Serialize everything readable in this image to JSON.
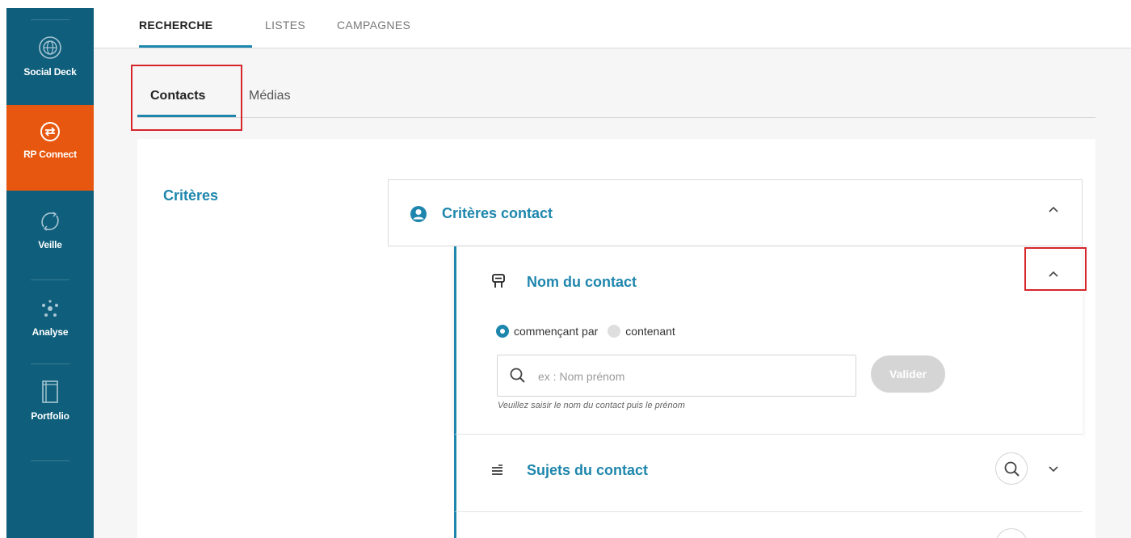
{
  "sidebar": {
    "items": [
      {
        "label": "Social Deck",
        "icon": "globe-icon"
      },
      {
        "label": "RP Connect",
        "icon": "exchange-icon",
        "active": true
      },
      {
        "label": "Veille",
        "icon": "refresh-icon"
      },
      {
        "label": "Analyse",
        "icon": "network-icon"
      },
      {
        "label": "Portfolio",
        "icon": "book-icon"
      }
    ],
    "colors": {
      "background": "#0f5f7c",
      "active": "#e8570f"
    }
  },
  "topnav": {
    "tabs": [
      {
        "label": "RECHERCHE",
        "active": true
      },
      {
        "label": "LISTES"
      },
      {
        "label": "CAMPAGNES"
      }
    ]
  },
  "subtabs": {
    "tabs": [
      {
        "label": "Contacts",
        "active": true
      },
      {
        "label": "Médias"
      }
    ]
  },
  "main": {
    "criteres_title": "Critères",
    "section": {
      "title": "Critères contact",
      "icon": "user-circle-icon"
    },
    "name_card": {
      "title": "Nom du contact",
      "icon": "sign-icon",
      "radio_options": [
        {
          "label": "commençant par",
          "selected": true
        },
        {
          "label": "contenant",
          "selected": false
        }
      ],
      "search_placeholder": "ex : Nom prénom",
      "search_value": "",
      "submit_label": "Valider",
      "hint": "Veuillez saisir le nom du contact puis le prénom"
    },
    "subjects_card": {
      "title": "Sujets du contact",
      "icon": "list-icon"
    }
  },
  "accent_color": "#1e86ad"
}
